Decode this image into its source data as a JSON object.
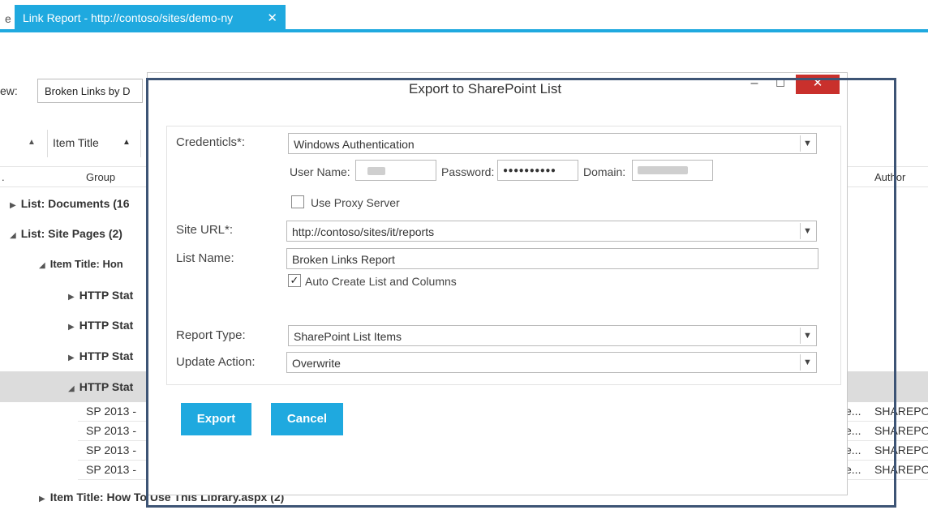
{
  "app": {
    "edge_letter": "e",
    "tab_title": "Link Report - http://contoso/sites/demo-ny",
    "tab_close": "✕"
  },
  "view": {
    "label": "ew:",
    "selected": "Broken Links by D"
  },
  "columns": {
    "sort_left": "",
    "item_title": "Item Title",
    "no_label": ".",
    "group": "Group",
    "author": "Author"
  },
  "groups": [
    "List: Documents (16",
    "List: Site Pages (2)",
    "Item Title: Hon",
    "HTTP Stat",
    "HTTP Stat",
    "HTTP Stat",
    "HTTP Stat"
  ],
  "grid_rows": [
    {
      "left": "SP 2013 -",
      "mid": "e...",
      "right": "SHAREPO"
    },
    {
      "left": "SP 2013 -",
      "mid": "e...",
      "right": "SHAREPO"
    },
    {
      "left": "SP 2013 -",
      "mid": "e...",
      "right": "SHAREPO"
    },
    {
      "left": "SP 2013 -",
      "mid": "e...",
      "right": "SHAREPO"
    }
  ],
  "footer_group": "Item Title: How To Use This Library.aspx (2)",
  "dialog": {
    "title": "Export to SharePoint List",
    "minimize": "–",
    "maximize": "☐",
    "close": "✕",
    "credentials_label": "Credenticls*:",
    "credentials_value": "Windows Authentication",
    "username_label": "User Name:",
    "password_label": "Password:",
    "password_value": "●●●●●●●●●●",
    "domain_label": "Domain:",
    "use_proxy_label": "Use Proxy Server",
    "site_url_label": "Site URL*:",
    "site_url_value": "http://contoso/sites/it/reports",
    "list_name_label": "List Name:",
    "list_name_value": "Broken Links Report",
    "auto_create_label": "Auto Create List and Columns",
    "auto_create_checked": "✓",
    "report_type_label": "Report Type:",
    "report_type_value": "SharePoint List Items",
    "update_action_label": "Update Action:",
    "update_action_value": "Overwrite",
    "export_label": "Export",
    "cancel_label": "Cancel"
  },
  "colors": {
    "accent": "#1fa9df",
    "close_red": "#c9302c",
    "frame": "#3d5475"
  }
}
